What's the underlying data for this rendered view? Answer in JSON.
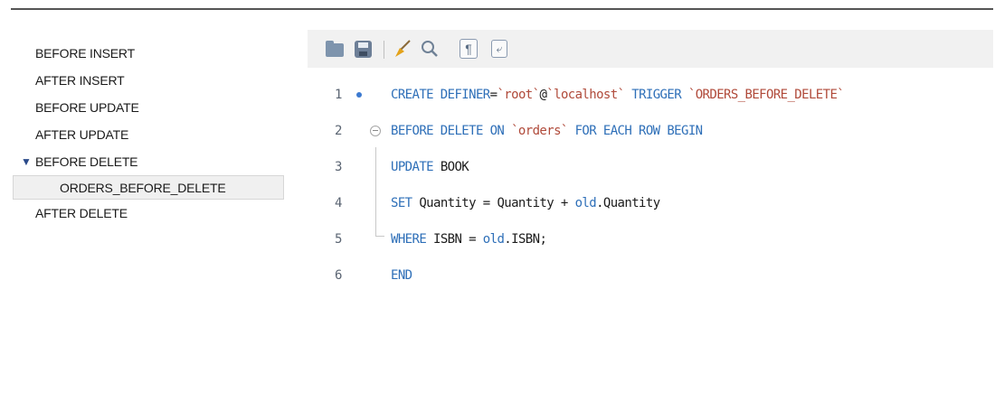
{
  "triggers": {
    "items": [
      "BEFORE INSERT",
      "AFTER INSERT",
      "BEFORE UPDATE",
      "AFTER UPDATE"
    ],
    "expanded_group": "BEFORE DELETE",
    "expanded_child": "ORDERS_BEFORE_DELETE",
    "after_delete": "AFTER DELETE",
    "expand_arrow": "▼"
  },
  "toolbar": {
    "icons": [
      "folder-open-icon",
      "save-icon",
      "broom-icon",
      "magnifier-icon",
      "pilcrow-icon",
      "word-wrap-icon"
    ],
    "pilcrow_glyph": "¶",
    "wrap_glyph": "⤶"
  },
  "editor": {
    "line_numbers": [
      "1",
      "2",
      "3",
      "4",
      "5",
      "6"
    ],
    "line1": {
      "kw1": "CREATE DEFINER",
      "eq": "=",
      "str1": "`root`",
      "at": "@",
      "str2": "`localhost`",
      "kw2": " TRIGGER ",
      "str3": "`ORDERS_BEFORE_DELETE`"
    },
    "line2": {
      "kw1": "BEFORE DELETE ON ",
      "str1": "`orders`",
      "kw2": " FOR EACH ROW BEGIN"
    },
    "line3": {
      "kw1": "UPDATE",
      "rest": " BOOK"
    },
    "line4": {
      "kw1": "SET",
      "mid": " Quantity = Quantity + ",
      "kw2": "old",
      "rest": ".Quantity"
    },
    "line5": {
      "kw1": "WHERE",
      "mid": " ISBN = ",
      "kw2": "old",
      "rest": ".ISBN;"
    },
    "line6": {
      "kw1": "END"
    }
  },
  "colors": {
    "keyword": "#2e6fb8",
    "string": "#b04a3a",
    "toolbar_bg": "#f1f1f1",
    "selection_bg": "#f0f0f0"
  }
}
